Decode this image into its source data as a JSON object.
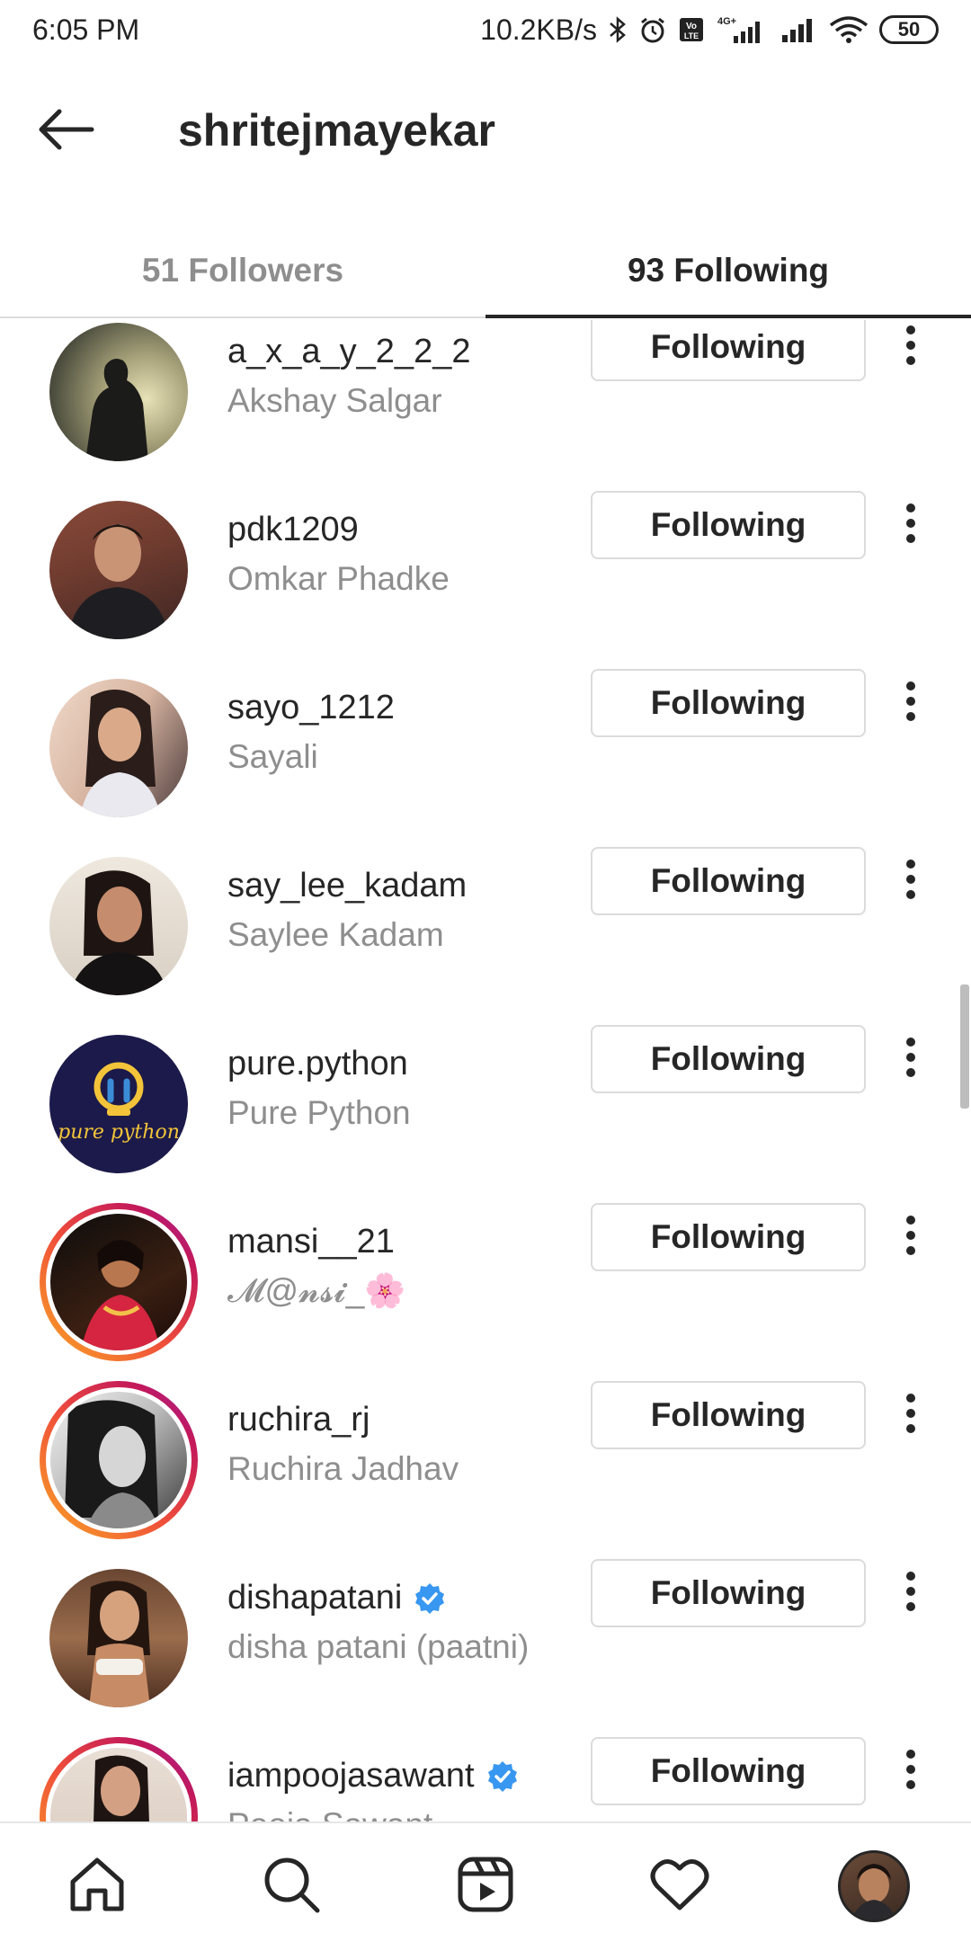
{
  "status_bar": {
    "time": "6:05 PM",
    "speed": "10.2KB/s",
    "network_label": "4G+",
    "battery": "50"
  },
  "header": {
    "title": "shritejmayekar",
    "back_icon": "arrow-left-icon"
  },
  "tabs": [
    {
      "label": "51 Followers",
      "active": false
    },
    {
      "label": "93 Following",
      "active": true
    }
  ],
  "following_list": [
    {
      "username": "a_x_a_y_2_2_2",
      "full_name": "Akshay Salgar",
      "button": "Following",
      "verified": false,
      "story": false
    },
    {
      "username": "pdk1209",
      "full_name": "Omkar Phadke",
      "button": "Following",
      "verified": false,
      "story": false
    },
    {
      "username": "sayo_1212",
      "full_name": "Sayali",
      "button": "Following",
      "verified": false,
      "story": false
    },
    {
      "username": "say_lee_kadam",
      "full_name": "Saylee Kadam",
      "button": "Following",
      "verified": false,
      "story": false
    },
    {
      "username": "pure.python",
      "full_name": "Pure Python",
      "button": "Following",
      "verified": false,
      "story": false
    },
    {
      "username": "mansi__21",
      "full_name": "𝓜@𝓷𝓼𝓲_🌸",
      "button": "Following",
      "verified": false,
      "story": true
    },
    {
      "username": "ruchira_rj",
      "full_name": "Ruchira Jadhav",
      "button": "Following",
      "verified": false,
      "story": true
    },
    {
      "username": "dishapatani",
      "full_name": "disha patani (paatni)",
      "button": "Following",
      "verified": true,
      "story": false
    },
    {
      "username": "iampoojasawant",
      "full_name": "Pooja Sawant",
      "button": "Following",
      "verified": true,
      "story": true
    }
  ],
  "pure_python_logo_text": "pure python",
  "bottom_nav": [
    "home-icon",
    "search-icon",
    "reels-icon",
    "heart-icon",
    "profile-avatar"
  ],
  "colors": {
    "text": "#262626",
    "secondary": "#8e8e8e",
    "border": "#dbdbdb",
    "verified": "#3897f0"
  }
}
